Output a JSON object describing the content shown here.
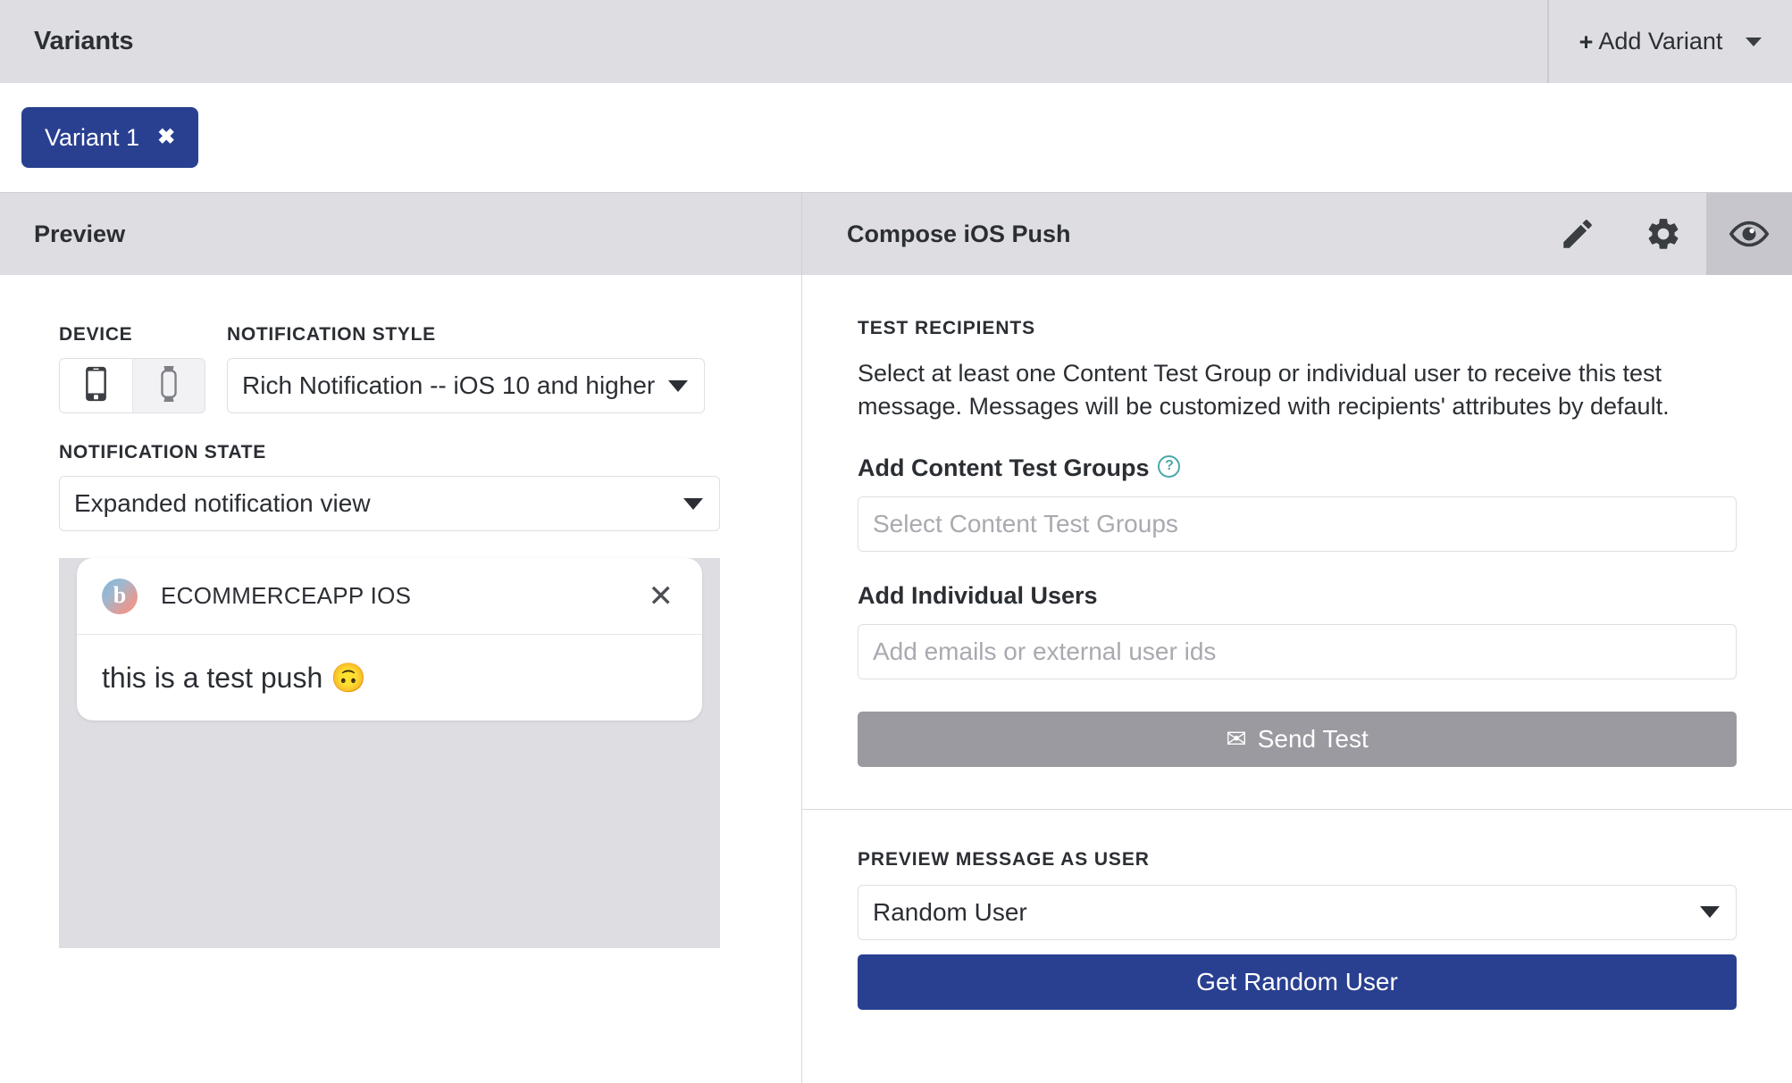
{
  "variants": {
    "title": "Variants",
    "add_variant_label": "Add Variant",
    "add_variant_plus": "+",
    "tabs": [
      {
        "label": "Variant 1",
        "close": "✖"
      }
    ]
  },
  "section_bar": {
    "left_title": "Preview",
    "right_title": "Compose iOS Push",
    "tools": [
      {
        "name": "pencil-icon",
        "active": false
      },
      {
        "name": "gear-icon",
        "active": false
      },
      {
        "name": "eye-icon",
        "active": true
      }
    ]
  },
  "preview": {
    "device_label": "DEVICE",
    "device_options": [
      "phone",
      "watch"
    ],
    "device_selected": "phone",
    "notification_style_label": "NOTIFICATION STYLE",
    "notification_style_value": "Rich Notification -- iOS 10 and higher",
    "notification_state_label": "NOTIFICATION STATE",
    "notification_state_value": "Expanded notification view",
    "notification": {
      "app_icon_letter": "b",
      "app_name": "ECOMMERCEAPP IOS",
      "close_glyph": "✕",
      "body_text": "this is a test push 🙃"
    }
  },
  "compose": {
    "test_recipients_heading": "TEST RECIPIENTS",
    "test_recipients_desc": "Select at least one Content Test Group or individual user to receive this test message. Messages will be customized with recipients' attributes by default.",
    "content_test_groups_label": "Add Content Test Groups",
    "content_test_groups_help": "?",
    "content_test_groups_placeholder": "Select Content Test Groups",
    "content_test_groups_value": "",
    "individual_users_label": "Add Individual Users",
    "individual_users_placeholder": "Add emails or external user ids",
    "individual_users_value": "",
    "send_test_label": "Send Test",
    "send_test_icon": "✉",
    "preview_as_user_heading": "PREVIEW MESSAGE AS USER",
    "preview_as_user_value": "Random User",
    "get_random_user_label": "Get Random User"
  },
  "colors": {
    "brand_blue": "#293f90",
    "header_gray": "#dedee2",
    "disabled_gray": "#9a9aa0",
    "help_teal": "#4aa9ae"
  }
}
